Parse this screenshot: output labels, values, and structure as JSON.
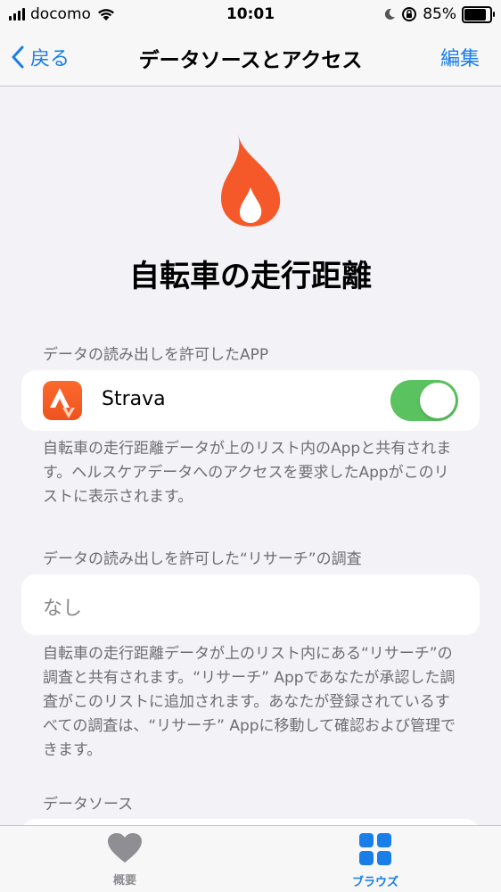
{
  "status_bar": {
    "carrier": "docomo",
    "time": "10:01",
    "battery_percent": "85%",
    "battery_level": 0.85
  },
  "nav": {
    "back_label": "戻る",
    "title": "データソースとアクセス",
    "edit_label": "編集",
    "accent_color": "#1a7ee8"
  },
  "hero": {
    "icon": "flame-icon",
    "icon_color": "#f5592a",
    "title": "自転車の走行距離"
  },
  "read_apps": {
    "header": "データの読み出しを許可したAPP",
    "items": [
      {
        "name": "Strava",
        "icon": "strava-icon",
        "enabled": true
      }
    ],
    "footer": "自転車の走行距離データが上のリスト内のAppと共有されます。ヘルスケアデータへのアクセスを要求したAppがこのリストに表示されます。"
  },
  "research": {
    "header": "データの読み出しを許可した“リサーチ”の調査",
    "empty_label": "なし",
    "footer": "自転車の走行距離データが上のリスト内にある“リサーチ”の調査と共有されます。“リサーチ” Appであなたが承認した調査がこのリストに追加されます。あなたが登録されているすべての調査は、“リサーチ” Appに移動して確認および管理できます。"
  },
  "data_sources": {
    "header": "データソース"
  },
  "tab_bar": {
    "tabs": [
      {
        "label": "概要",
        "icon": "heart-icon",
        "active": false
      },
      {
        "label": "ブラウズ",
        "icon": "grid-icon",
        "active": true
      }
    ],
    "inactive_color": "#8e8e93",
    "active_color": "#1a7ee8"
  }
}
